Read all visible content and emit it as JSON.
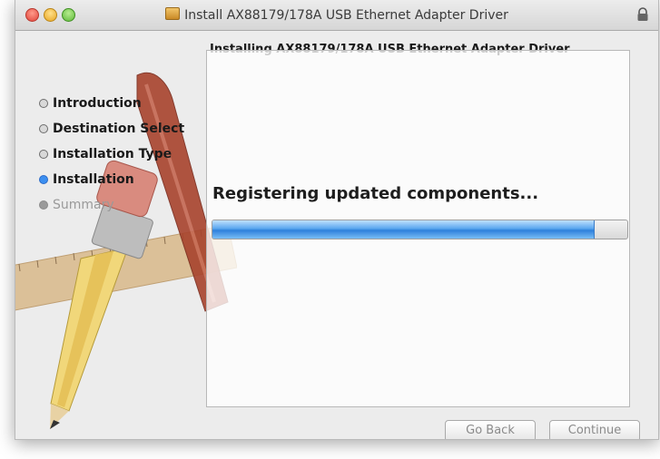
{
  "window": {
    "title": "Install AX88179/178A USB Ethernet Adapter Driver"
  },
  "header": {
    "text": "Installing AX88179/178A USB Ethernet Adapter Driver"
  },
  "sidebar": {
    "steps": [
      {
        "label": "Introduction",
        "state": "done"
      },
      {
        "label": "Destination Select",
        "state": "done"
      },
      {
        "label": "Installation Type",
        "state": "done"
      },
      {
        "label": "Installation",
        "state": "active"
      },
      {
        "label": "Summary",
        "state": "pending"
      }
    ]
  },
  "main": {
    "status": "Registering updated components...",
    "progress": 0.92
  },
  "buttons": {
    "back": "Go Back",
    "continue": "Continue"
  },
  "colors": {
    "active_step": "#3c8ff0",
    "progress_fill": "#2e80dc"
  },
  "icons": {
    "package": "package-icon",
    "lock": "lock-icon"
  }
}
